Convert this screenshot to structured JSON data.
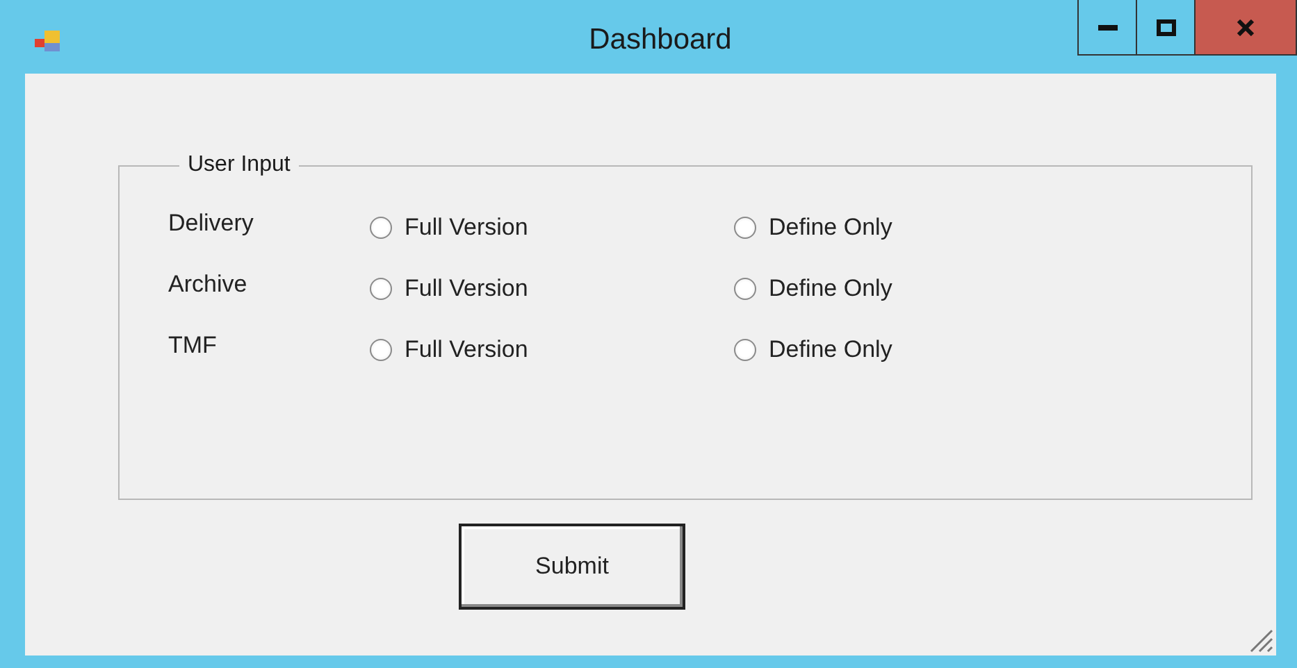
{
  "window": {
    "title": "Dashboard"
  },
  "group": {
    "title": "User Input",
    "rows": [
      {
        "label": "Delivery",
        "options": [
          {
            "label": "Full Version",
            "selected": false
          },
          {
            "label": "Define Only",
            "selected": false
          }
        ]
      },
      {
        "label": "Archive",
        "options": [
          {
            "label": "Full Version",
            "selected": false
          },
          {
            "label": "Define Only",
            "selected": false
          }
        ]
      },
      {
        "label": "TMF",
        "options": [
          {
            "label": "Full Version",
            "selected": false
          },
          {
            "label": "Define Only",
            "selected": false
          }
        ]
      }
    ]
  },
  "submit": "Submit"
}
